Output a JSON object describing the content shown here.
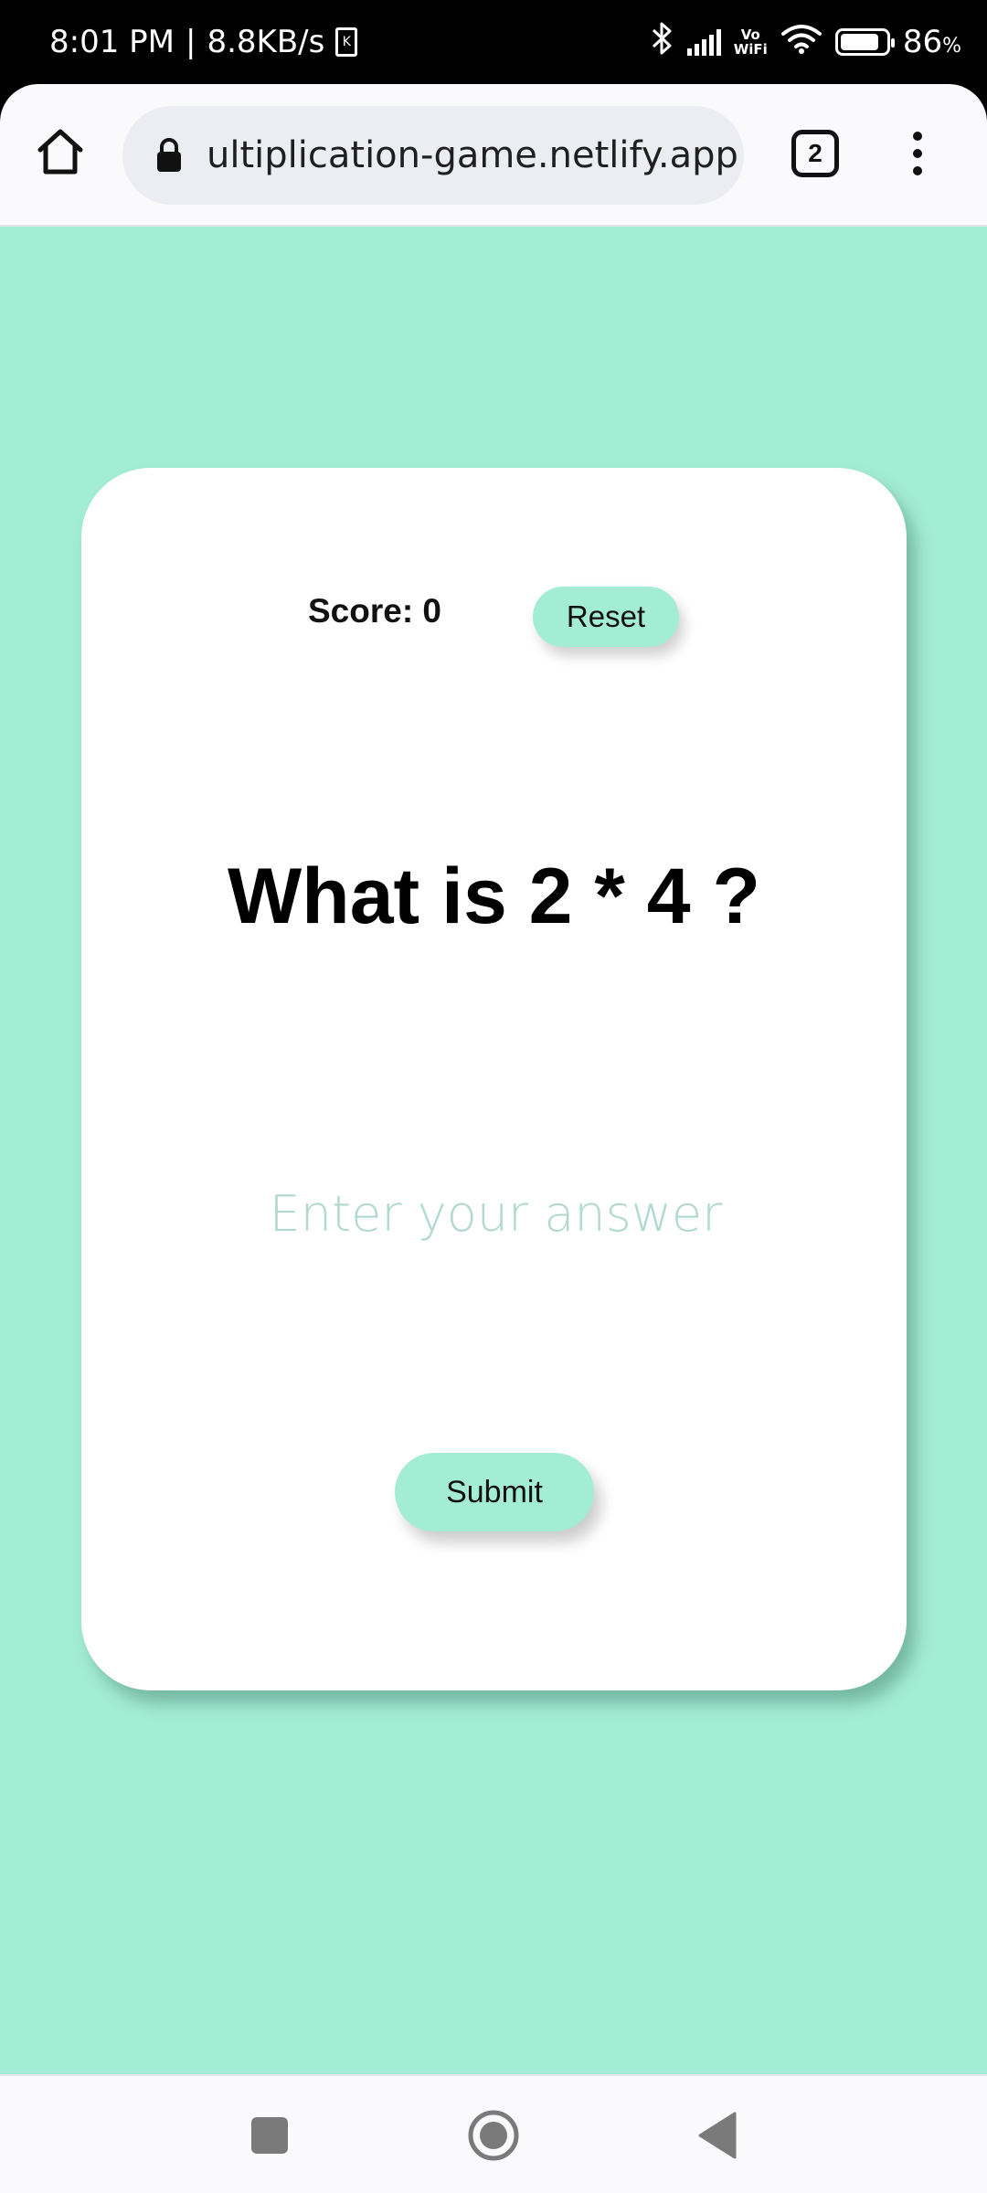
{
  "status_bar": {
    "time": "8:01 PM",
    "separator": "|",
    "network_speed": "8.8KB/s",
    "sim_badge": "K",
    "vowifi_top": "Vo",
    "vowifi_bottom": "WiFi",
    "battery_level": 86,
    "battery_percent": "86",
    "battery_symbol": "%",
    "icons": [
      "sim-card-icon",
      "bluetooth-icon",
      "cell-signal-icon",
      "vowifi-icon",
      "wifi-icon",
      "battery-icon"
    ]
  },
  "browser": {
    "url": "ultiplication-game.netlify.app",
    "tab_count": "2",
    "icons": [
      "home-icon",
      "lock-icon",
      "tabs-icon",
      "more-vert-icon"
    ]
  },
  "game": {
    "score_label": "Score: 0",
    "reset_label": "Reset",
    "question": "What is 2 * 4 ?",
    "answer_placeholder": "Enter your answer",
    "answer_value": "",
    "submit_label": "Submit"
  },
  "navigation": {
    "icons": [
      "recents-square-icon",
      "home-circle-icon",
      "back-triangle-icon"
    ]
  },
  "colors": {
    "page_background": "#a4edd5",
    "card_background": "#ffffff",
    "button_background": "#a4edd5",
    "placeholder_text": "#b2d9cf"
  }
}
